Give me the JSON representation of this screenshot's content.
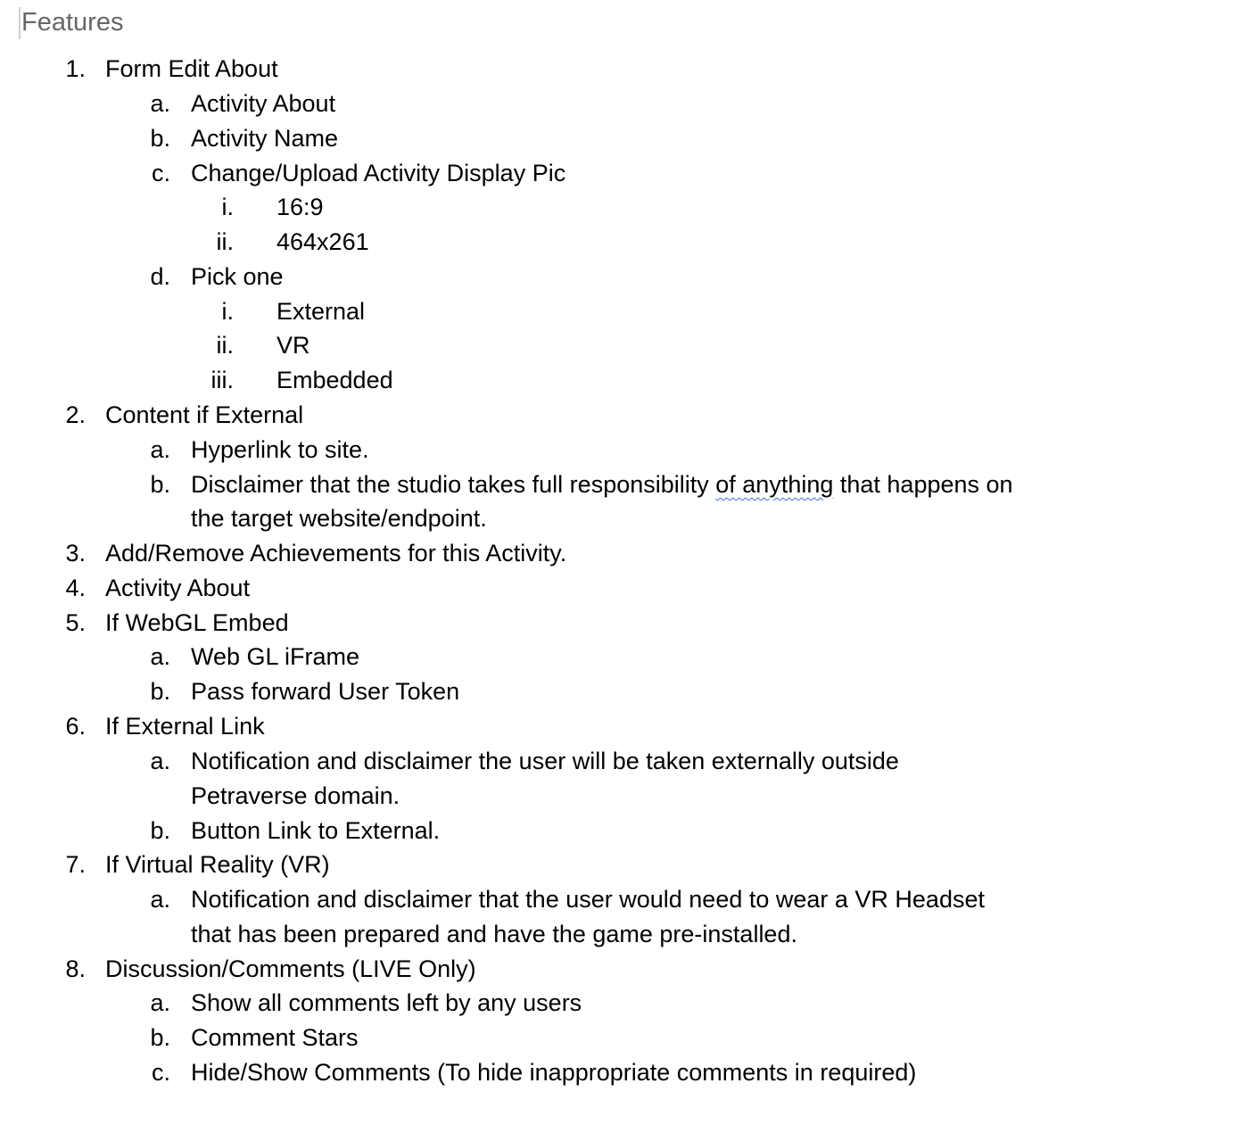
{
  "document": {
    "title": "Features",
    "items": [
      {
        "marker": "1.",
        "text": "Form Edit About"
      },
      {
        "marker": "a.",
        "text": "Activity About"
      },
      {
        "marker": "b.",
        "text": "Activity Name"
      },
      {
        "marker": "c.",
        "text": "Change/Upload Activity Display Pic"
      },
      {
        "marker": "i.",
        "text": "16:9"
      },
      {
        "marker": "ii.",
        "text": "464x261"
      },
      {
        "marker": "d.",
        "text": "Pick one"
      },
      {
        "marker": "i.",
        "text": "External"
      },
      {
        "marker": "ii.",
        "text": "VR"
      },
      {
        "marker": "iii.",
        "text": "Embedded"
      },
      {
        "marker": "2.",
        "text": "Content if External"
      },
      {
        "marker": "a.",
        "text": "Hyperlink to site."
      },
      {
        "marker": "b.",
        "text_before": "Disclaimer that the studio takes full responsibility ",
        "text_flagged": "of anything",
        "text_after": " that happens on",
        "text_cont": "the target website/endpoint."
      },
      {
        "marker": "3.",
        "text": "Add/Remove Achievements for this Activity."
      },
      {
        "marker": "4.",
        "text": "Activity About"
      },
      {
        "marker": "5.",
        "text": "If WebGL Embed"
      },
      {
        "marker": "a.",
        "text": "Web GL iFrame"
      },
      {
        "marker": "b.",
        "text": "Pass forward User Token"
      },
      {
        "marker": "6.",
        "text": "If External Link"
      },
      {
        "marker": "a.",
        "text": "Notification and disclaimer the user will be taken externally outside",
        "text_cont": "Petraverse domain."
      },
      {
        "marker": "b.",
        "text": "Button Link to External."
      },
      {
        "marker": "7.",
        "text": "If Virtual Reality (VR)"
      },
      {
        "marker": "a.",
        "text": "Notification and disclaimer that the user would need to wear a VR Headset",
        "text_cont": "that has been prepared and have the game pre-installed."
      },
      {
        "marker": "8.",
        "text": "Discussion/Comments (LIVE Only)"
      },
      {
        "marker": "a.",
        "text": "Show all comments left by any users"
      },
      {
        "marker": "b.",
        "text": "Comment Stars"
      },
      {
        "marker": "c.",
        "text": "Hide/Show Comments (To hide inappropriate comments in required)"
      }
    ]
  },
  "colors": {
    "title": "#666666",
    "text": "#000000",
    "spellcheck_underline": "#3b6fd6",
    "cursor": "#d0d0d0"
  }
}
